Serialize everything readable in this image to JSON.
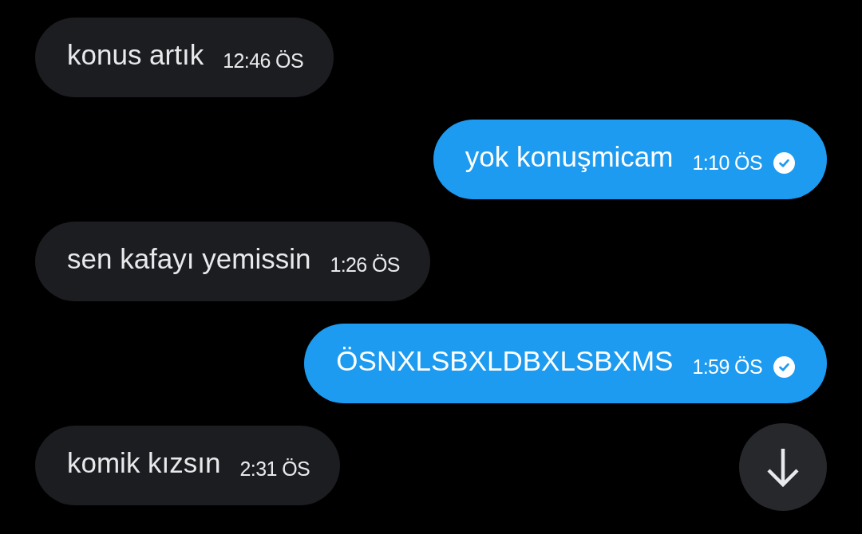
{
  "messages": [
    {
      "kind": "incoming",
      "text": "konus artık",
      "time": "12:46 ÖS"
    },
    {
      "kind": "outgoing",
      "text": "yok konuşmicam",
      "time": "1:10 ÖS",
      "read": true
    },
    {
      "kind": "incoming",
      "text": "sen kafayı yemissin",
      "time": "1:26 ÖS"
    },
    {
      "kind": "outgoing",
      "text": "ÖSNXLSBXLDBXLSBXMS",
      "time": "1:59 ÖS",
      "read": true
    },
    {
      "kind": "incoming",
      "text": "komik kızsın",
      "time": "2:31 ÖS"
    }
  ]
}
